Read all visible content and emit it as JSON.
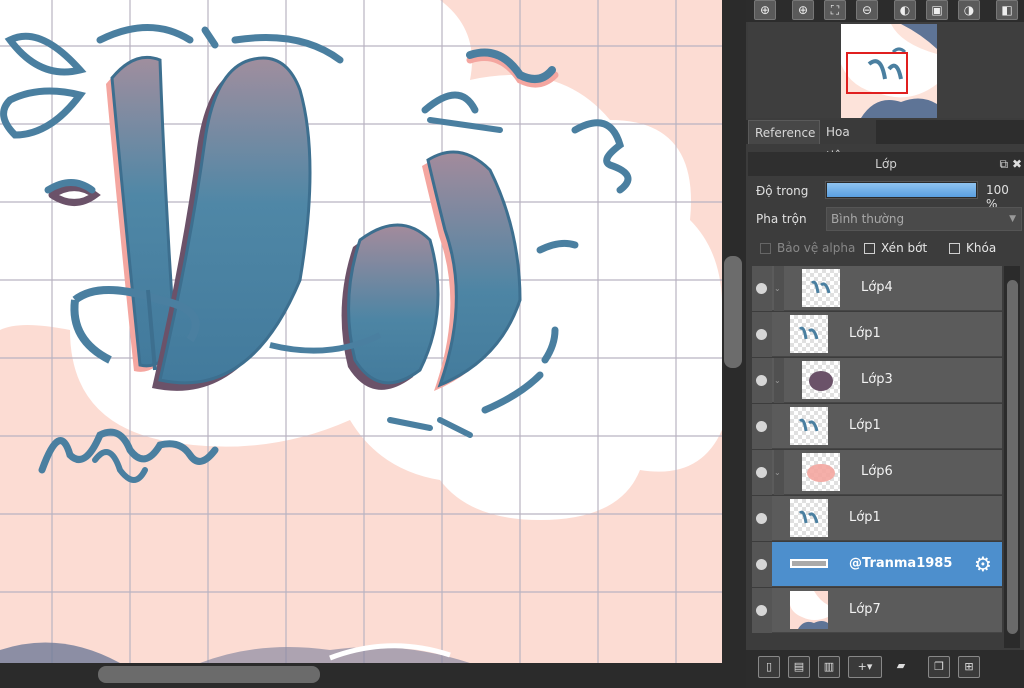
{
  "navigator_toolbar": {
    "buttons": [
      {
        "icon": "zoom-fit-icon",
        "glyph": "⊕"
      },
      {
        "icon": "zoom-in-icon",
        "glyph": "⊕"
      },
      {
        "icon": "fit-screen-icon",
        "glyph": "⛶"
      },
      {
        "icon": "zoom-out-icon",
        "glyph": "⊖"
      },
      {
        "icon": "rotate-left-icon",
        "glyph": "◐"
      },
      {
        "icon": "reset-rotate-icon",
        "glyph": "▣"
      },
      {
        "icon": "rotate-right-icon",
        "glyph": "◑"
      },
      {
        "icon": "flip-horizontal-icon",
        "glyph": "◧"
      }
    ]
  },
  "tabs": {
    "reference": "Reference",
    "navigator": "Hoa tiêu"
  },
  "layer_panel": {
    "title": "Lớp",
    "opacity_label": "Độ trong",
    "opacity_value": "100 %",
    "opacity_fraction": 1.0,
    "blend_label": "Pha trộn",
    "blend_value": "Bình thường",
    "protect_alpha": "Bảo vệ alpha",
    "clipping": "Xén bớt",
    "lock": "Khóa"
  },
  "layers": [
    {
      "name": "Lớp4",
      "folder": true,
      "thumb": "lettering"
    },
    {
      "name": "Lớp1",
      "folder": false,
      "thumb": "lettering"
    },
    {
      "name": "Lớp3",
      "folder": true,
      "thumb": "blob"
    },
    {
      "name": "Lớp1",
      "folder": false,
      "thumb": "lettering"
    },
    {
      "name": "Lớp6",
      "folder": true,
      "thumb": "pink"
    },
    {
      "name": "Lớp1",
      "folder": false,
      "thumb": "lettering"
    },
    {
      "name": "@Tranma1985",
      "folder": false,
      "thumb": "watermark",
      "selected": true
    },
    {
      "name": "Lớp7",
      "folder": false,
      "thumb": "background"
    }
  ],
  "colors": {
    "canvas_bg": "#fcdcd3",
    "ink_blue": "#4a7fa0",
    "shadow_mauve": "#6b5269",
    "selection": "#4d8fcd"
  }
}
